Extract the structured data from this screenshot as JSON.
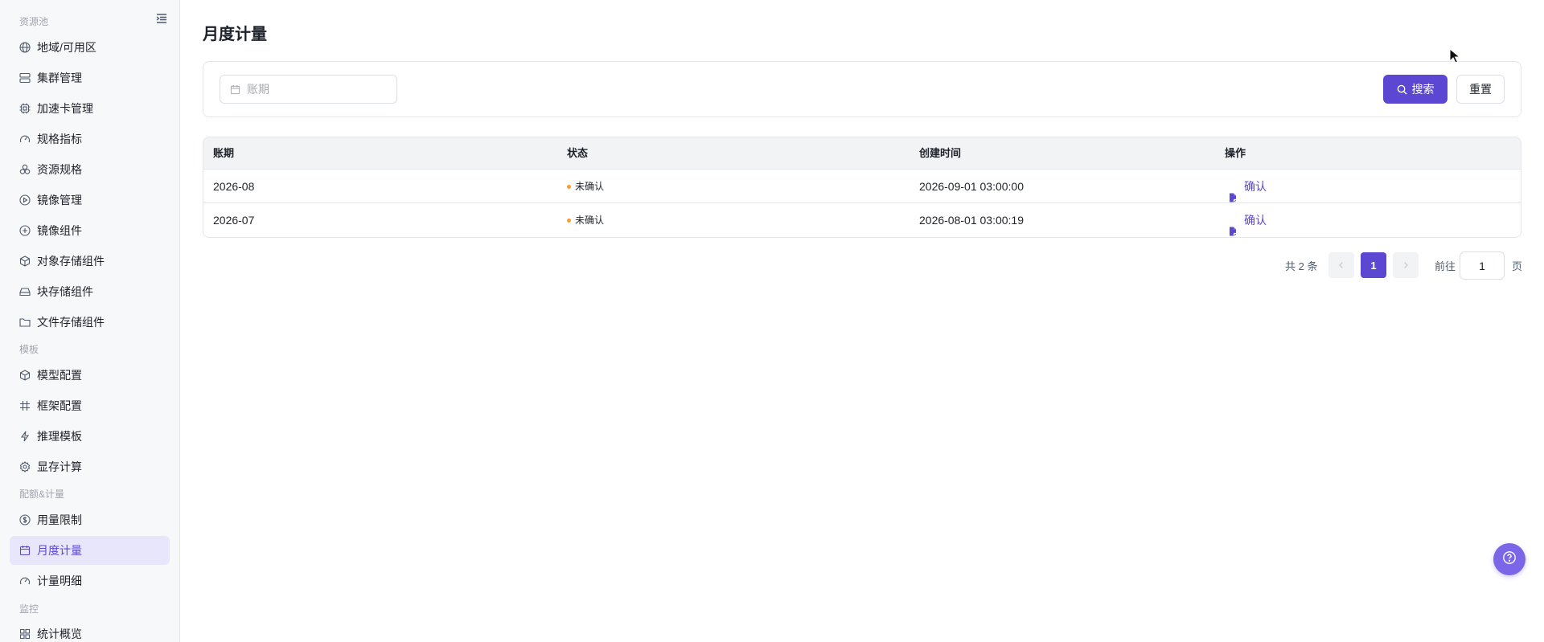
{
  "sidebar": {
    "groups": {
      "resource_pool": "资源池",
      "template": "模板",
      "quota": "配额&计量",
      "monitor": "监控"
    },
    "items": [
      {
        "label": "地域/可用区",
        "icon": "globe-icon"
      },
      {
        "label": "集群管理",
        "icon": "server-icon"
      },
      {
        "label": "加速卡管理",
        "icon": "chip-icon"
      },
      {
        "label": "规格指标",
        "icon": "gauge-icon"
      },
      {
        "label": "资源规格",
        "icon": "shapes-icon"
      },
      {
        "label": "镜像管理",
        "icon": "disc-icon"
      },
      {
        "label": "镜像组件",
        "icon": "disc-plus-icon"
      },
      {
        "label": "对象存储组件",
        "icon": "box-icon"
      },
      {
        "label": "块存储组件",
        "icon": "drive-icon"
      },
      {
        "label": "文件存储组件",
        "icon": "folder-icon"
      },
      {
        "label": "模型配置",
        "icon": "cube-icon"
      },
      {
        "label": "框架配置",
        "icon": "hash-icon"
      },
      {
        "label": "推理模板",
        "icon": "bolt-icon"
      },
      {
        "label": "显存计算",
        "icon": "gear-icon"
      },
      {
        "label": "用量限制",
        "icon": "coin-icon"
      },
      {
        "label": "月度计量",
        "icon": "calendar-icon"
      },
      {
        "label": "计量明细",
        "icon": "gauge-icon"
      },
      {
        "label": "统计概览",
        "icon": "grid-icon"
      }
    ]
  },
  "page": {
    "title": "月度计量"
  },
  "filter": {
    "period_placeholder": "账期",
    "search_label": "搜索",
    "reset_label": "重置"
  },
  "table": {
    "columns": [
      "账期",
      "状态",
      "创建时间",
      "操作"
    ],
    "rows": [
      {
        "period": "2026-08",
        "status": "未确认",
        "created": "2026-09-01 03:00:00",
        "action": "确认"
      },
      {
        "period": "2026-07",
        "status": "未确认",
        "created": "2026-08-01 03:00:19",
        "action": "确认"
      }
    ]
  },
  "pagination": {
    "total": "共 2 条",
    "current": "1",
    "goto_label": "前往",
    "goto_value": "1",
    "page_label": "页"
  },
  "colors": {
    "accent": "#5b47d1",
    "status_pending": "#ff9a2e"
  }
}
